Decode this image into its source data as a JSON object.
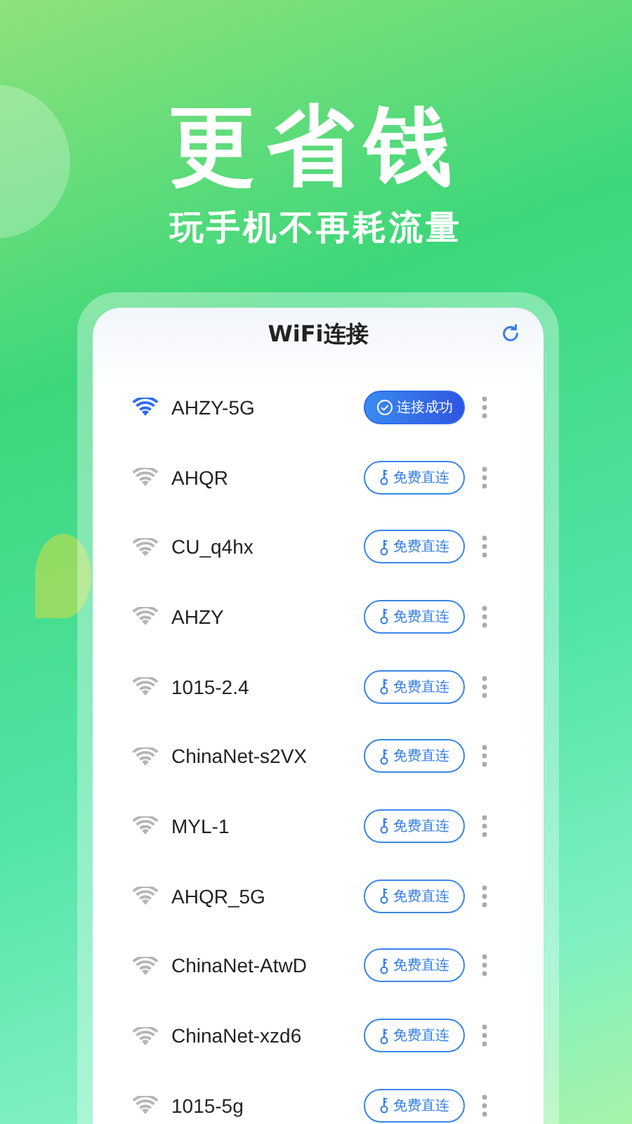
{
  "headline": "更省钱",
  "subtitle": "玩手机不再耗流量",
  "panel": {
    "title": "WiFi连接"
  },
  "networks": [
    {
      "name": "AHZY-5G",
      "connected": true,
      "action": "连接成功"
    },
    {
      "name": "AHQR",
      "connected": false,
      "action": "免费直连"
    },
    {
      "name": "CU_q4hx",
      "connected": false,
      "action": "免费直连"
    },
    {
      "name": "AHZY",
      "connected": false,
      "action": "免费直连"
    },
    {
      "name": "1015-2.4",
      "connected": false,
      "action": "免费直连"
    },
    {
      "name": "ChinaNet-s2VX",
      "connected": false,
      "action": "免费直连"
    },
    {
      "name": "MYL-1",
      "connected": false,
      "action": "免费直连"
    },
    {
      "name": "AHQR_5G",
      "connected": false,
      "action": "免费直连"
    },
    {
      "name": "ChinaNet-AtwD",
      "connected": false,
      "action": "免费直连"
    },
    {
      "name": "ChinaNet-xzd6",
      "connected": false,
      "action": "免费直连"
    },
    {
      "name": "1015-5g",
      "connected": false,
      "action": "免费直连"
    }
  ]
}
